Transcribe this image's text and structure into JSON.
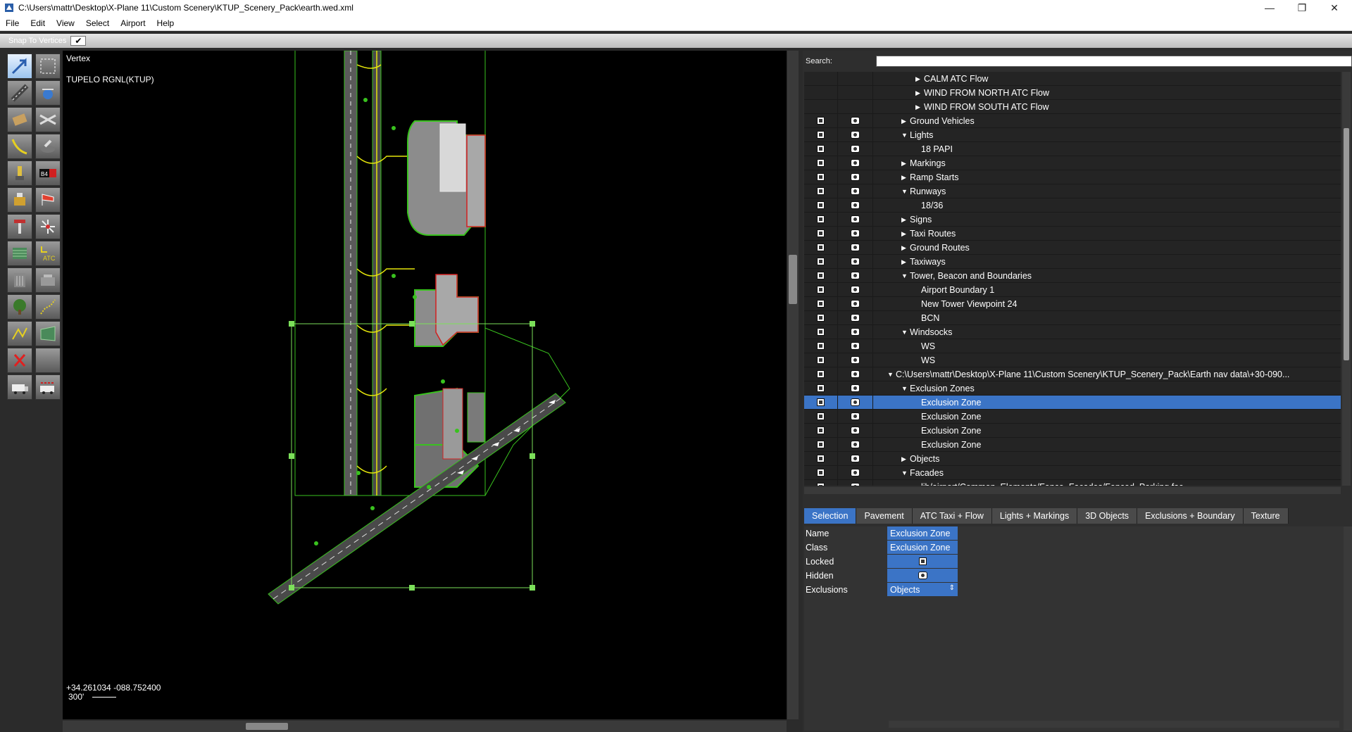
{
  "window": {
    "title": "C:\\Users\\mattr\\Desktop\\X-Plane 11\\Custom Scenery\\KTUP_Scenery_Pack\\earth.wed.xml",
    "controls": [
      "minimize",
      "maximize",
      "close"
    ]
  },
  "menu": [
    "File",
    "Edit",
    "View",
    "Select",
    "Airport",
    "Help"
  ],
  "tool_options": {
    "snap_label": "Snap To Vertices",
    "snap_checked": "✔"
  },
  "toolbox": {
    "icons": [
      "vertex-tool-icon",
      "marquee-tool-icon",
      "runway-tool-icon",
      "helipad-tool-icon",
      "sealane-tool-icon",
      "taxiway-tool-icon",
      "taxiline-tool-icon",
      "hole-tool-icon",
      "boundary-tool-icon",
      "light-tool-icon",
      "sign-tool-icon",
      "windsock-tool-icon",
      "beacon-tool-icon",
      "tower-tool-icon",
      "ramp-start-tool-icon",
      "exclusion-tool-icon",
      "atc-flow-tool-icon",
      "facade-tool-icon",
      "object-tool-icon",
      "forest-tool-icon",
      "string-tool-icon",
      "line-tool-icon",
      "polygon-tool-icon",
      "delete-tool-icon",
      "route-tool-icon",
      "ground-vehicle-tool-icon"
    ],
    "atc_label": "ATC",
    "sign_label": "B4"
  },
  "map": {
    "tool_name": "Vertex",
    "airport_name": "TUPELO RGNL(KTUP)",
    "coords": "+34.261034 -088.752400",
    "scale_label": "300'"
  },
  "search": {
    "label": "Search:",
    "value": ""
  },
  "tree": [
    {
      "indent": 3,
      "tri": "▶",
      "label": "CALM ATC Flow",
      "icons": false
    },
    {
      "indent": 3,
      "tri": "▶",
      "label": "WIND FROM NORTH ATC Flow",
      "icons": false
    },
    {
      "indent": 3,
      "tri": "▶",
      "label": "WIND FROM SOUTH ATC Flow",
      "icons": false
    },
    {
      "indent": 2,
      "tri": "▶",
      "label": "Ground Vehicles",
      "icons": true
    },
    {
      "indent": 2,
      "tri": "▼",
      "label": "Lights",
      "icons": true
    },
    {
      "indent": 3,
      "tri": "",
      "label": "18  PAPI",
      "icons": true
    },
    {
      "indent": 2,
      "tri": "▶",
      "label": "Markings",
      "icons": true
    },
    {
      "indent": 2,
      "tri": "▶",
      "label": "Ramp Starts",
      "icons": true
    },
    {
      "indent": 2,
      "tri": "▼",
      "label": "Runways",
      "icons": true
    },
    {
      "indent": 3,
      "tri": "",
      "label": "18/36",
      "icons": true
    },
    {
      "indent": 2,
      "tri": "▶",
      "label": "Signs",
      "icons": true
    },
    {
      "indent": 2,
      "tri": "▶",
      "label": "Taxi Routes",
      "icons": true
    },
    {
      "indent": 2,
      "tri": "▶",
      "label": "Ground Routes",
      "icons": true
    },
    {
      "indent": 2,
      "tri": "▶",
      "label": "Taxiways",
      "icons": true
    },
    {
      "indent": 2,
      "tri": "▼",
      "label": "Tower, Beacon and Boundaries",
      "icons": true
    },
    {
      "indent": 3,
      "tri": "",
      "label": "Airport Boundary 1",
      "icons": true
    },
    {
      "indent": 3,
      "tri": "",
      "label": "New Tower Viewpoint 24",
      "icons": true
    },
    {
      "indent": 3,
      "tri": "",
      "label": "BCN",
      "icons": true
    },
    {
      "indent": 2,
      "tri": "▼",
      "label": "Windsocks",
      "icons": true
    },
    {
      "indent": 3,
      "tri": "",
      "label": "WS",
      "icons": true
    },
    {
      "indent": 3,
      "tri": "",
      "label": "WS",
      "icons": true
    },
    {
      "indent": 1,
      "tri": "▼",
      "label": "C:\\Users\\mattr\\Desktop\\X-Plane 11\\Custom Scenery\\KTUP_Scenery_Pack\\Earth nav data\\+30-090...",
      "icons": true
    },
    {
      "indent": 2,
      "tri": "▼",
      "label": "Exclusion Zones",
      "icons": true
    },
    {
      "indent": 3,
      "tri": "",
      "label": "Exclusion Zone",
      "icons": true,
      "selected": true
    },
    {
      "indent": 3,
      "tri": "",
      "label": "Exclusion Zone",
      "icons": true
    },
    {
      "indent": 3,
      "tri": "",
      "label": "Exclusion Zone",
      "icons": true
    },
    {
      "indent": 3,
      "tri": "",
      "label": "Exclusion Zone",
      "icons": true
    },
    {
      "indent": 2,
      "tri": "▶",
      "label": "Objects",
      "icons": true
    },
    {
      "indent": 2,
      "tri": "▼",
      "label": "Facades",
      "icons": true
    },
    {
      "indent": 3,
      "tri": "",
      "label": "lib/airport/Common_Elements/Fence_Facades/Fenced_Parking.fac",
      "icons": true
    }
  ],
  "tabs": [
    {
      "label": "Selection",
      "active": true
    },
    {
      "label": "Pavement"
    },
    {
      "label": "ATC Taxi + Flow"
    },
    {
      "label": "Lights + Markings"
    },
    {
      "label": "3D Objects"
    },
    {
      "label": "Exclusions + Boundary"
    },
    {
      "label": "Texture"
    }
  ],
  "properties": [
    {
      "key": "Name",
      "value": "Exclusion Zone"
    },
    {
      "key": "Class",
      "value": "Exclusion Zone"
    },
    {
      "key": "Locked",
      "icon": "lock-icon"
    },
    {
      "key": "Hidden",
      "icon": "eye-icon"
    },
    {
      "key": "Exclusions",
      "value": "Objects",
      "dropdown": "⇕"
    }
  ],
  "colors": {
    "selection": "#3b74c6",
    "airport_outline": "#39c21e",
    "taxi_line": "#e6e60a",
    "pavement": "#8c8c8c",
    "building_outline": "#d22020",
    "background": "#000000"
  }
}
